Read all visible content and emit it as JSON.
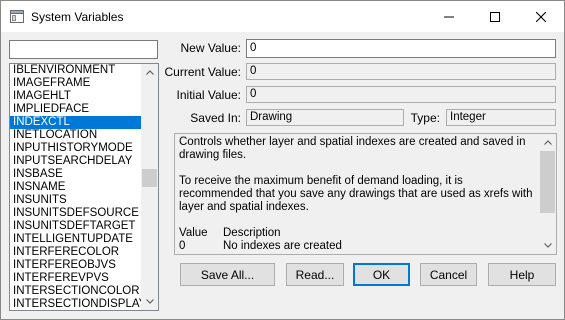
{
  "window": {
    "title": "System Variables",
    "icon": "app-window-icon",
    "controls": {
      "minimize_icon": "minimize-icon",
      "maximize_icon": "maximize-icon",
      "close_icon": "close-icon"
    }
  },
  "filter": {
    "value": ""
  },
  "variables": {
    "items": [
      "IBLENVIRONMENT",
      "IMAGEFRAME",
      "IMAGEHLT",
      "IMPLIEDFACE",
      "INDEXCTL",
      "INETLOCATION",
      "INPUTHISTORYMODE",
      "INPUTSEARCHDELAY",
      "INSBASE",
      "INSNAME",
      "INSUNITS",
      "INSUNITSDEFSOURCE",
      "INSUNITSDEFTARGET",
      "INTELLIGENTUPDATE",
      "INTERFERECOLOR",
      "INTERFEREOBJVS",
      "INTERFEREVPVS",
      "INTERSECTIONCOLOR",
      "INTERSECTIONDISPLAY"
    ],
    "selected": "INDEXCTL"
  },
  "form": {
    "new_value_label": "New Value:",
    "new_value": "0",
    "current_value_label": "Current Value:",
    "current_value": "0",
    "initial_value_label": "Initial Value:",
    "initial_value": "0",
    "saved_in_label": "Saved In:",
    "saved_in": "Drawing",
    "type_label": "Type:",
    "type": "Integer"
  },
  "description": {
    "para1": "Controls whether layer and spatial indexes are created and saved in drawing files.",
    "para2": "To receive the maximum benefit of demand loading, it is recommended that you save any drawings that are used as xrefs with layer and spatial indexes.",
    "col_value": "Value",
    "col_description": "Description",
    "rows": [
      {
        "value": "0",
        "description": "No indexes are created"
      }
    ]
  },
  "buttons": {
    "save_all": "Save All...",
    "read": "Read...",
    "ok": "OK",
    "cancel": "Cancel",
    "help": "Help"
  }
}
